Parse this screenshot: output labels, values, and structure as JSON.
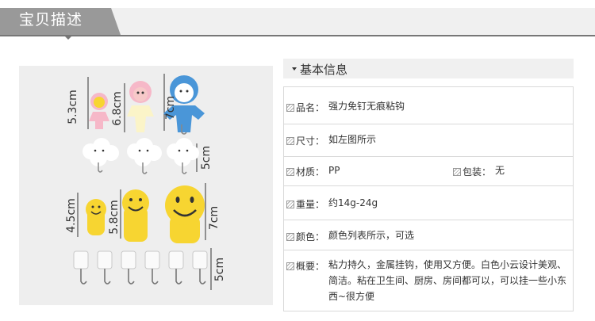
{
  "header": {
    "title": "宝贝描述"
  },
  "info_panel": {
    "title": "基本信息",
    "rows": [
      {
        "label": "品名：",
        "value": "强力免钉无痕粘钩"
      },
      {
        "label": "尺寸：",
        "value": "如左图所示"
      },
      {
        "label": "材质：",
        "value": "PP",
        "label2": "包装：",
        "value2": "无"
      },
      {
        "label": "重量：",
        "value": "约14g-24g"
      },
      {
        "label": "颜色：",
        "value": "颜色列表所示，可选"
      },
      {
        "label": "概要：",
        "value": "粘力持久，金属挂钩，使用又方便。白色小云设计美观、简洁。粘在卫生间、厨房、房间都可以，可以挂一些小东西~很方便"
      }
    ]
  },
  "product_image": {
    "dimension_labels": {
      "girl_small": "5.3cm",
      "girl_large": "6.8cm",
      "boy": "7cm",
      "clouds": "5cm",
      "smiley_small": "4.5cm",
      "smiley_medium": "5.8cm",
      "smiley_large": "7cm",
      "clear_hooks": "5cm"
    },
    "colors": {
      "background": "#eeeeee",
      "yellow": "#f7d531",
      "pink": "#f6b8c8",
      "blue": "#4a96d8",
      "cream": "#fbf4c8",
      "cloud": "#ffffff"
    }
  },
  "colors": {
    "header_tab": "#999999",
    "header_bg": "#f0f0f0",
    "border": "#d9d9d9",
    "text": "#333333"
  }
}
